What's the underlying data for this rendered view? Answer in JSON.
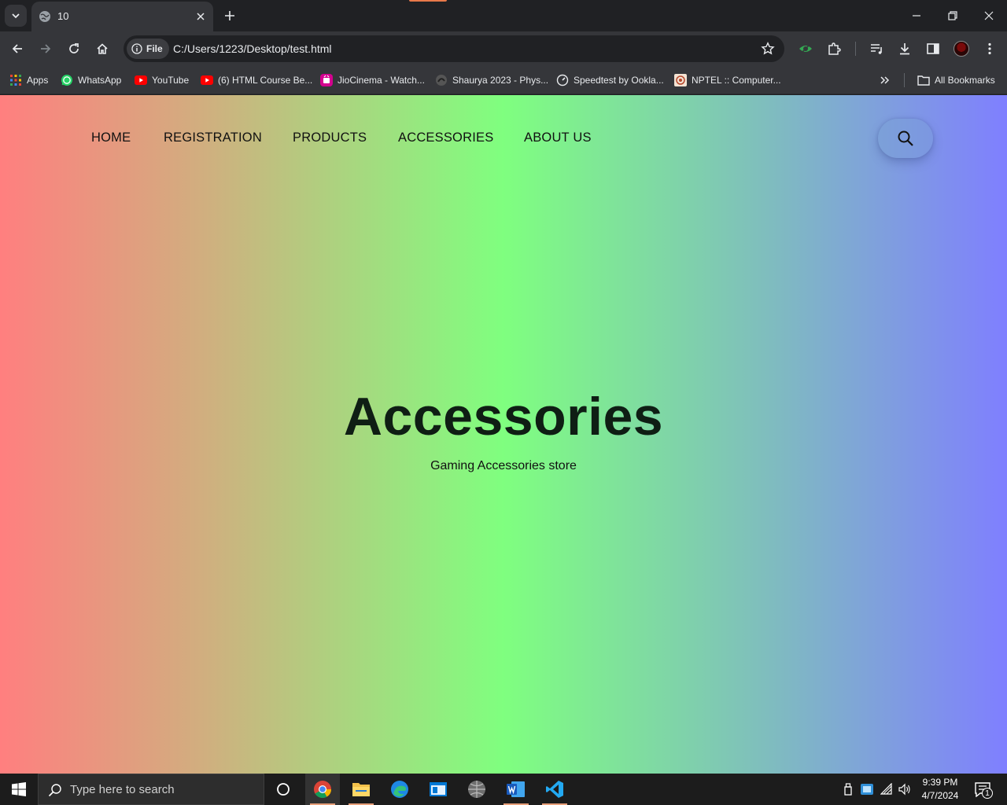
{
  "browser": {
    "tab": {
      "title": "10"
    },
    "address": {
      "chip_label": "File",
      "url": "C:/Users/1223/Desktop/test.html"
    },
    "bookmarks": [
      {
        "label": "Apps",
        "icon": "apps-grid-icon"
      },
      {
        "label": "WhatsApp",
        "icon": "whatsapp-icon"
      },
      {
        "label": "YouTube",
        "icon": "youtube-icon"
      },
      {
        "label": "(6) HTML Course Be...",
        "icon": "youtube-icon"
      },
      {
        "label": "JioCinema - Watch...",
        "icon": "jiocinema-icon"
      },
      {
        "label": "Shaurya 2023 - Phys...",
        "icon": "shaurya-icon"
      },
      {
        "label": "Speedtest by Ookla...",
        "icon": "speedtest-icon"
      },
      {
        "label": "NPTEL :: Computer...",
        "icon": "nptel-icon"
      }
    ],
    "all_bookmarks_label": "All Bookmarks"
  },
  "page": {
    "nav": [
      "HOME",
      "REGISTRATION",
      "PRODUCTS",
      "ACCESSORIES",
      "ABOUT US"
    ],
    "hero": {
      "title": "Accessories",
      "subtitle": "Gaming Accessories store"
    },
    "colors": {
      "gradient": [
        "#ff7f7f",
        "#d1ae7f",
        "#7fff7f",
        "#7fbbc0",
        "#7f7fff"
      ]
    }
  },
  "taskbar": {
    "search_placeholder": "Type here to search",
    "time": "9:39 PM",
    "date": "4/7/2024",
    "notification_count": "1"
  }
}
